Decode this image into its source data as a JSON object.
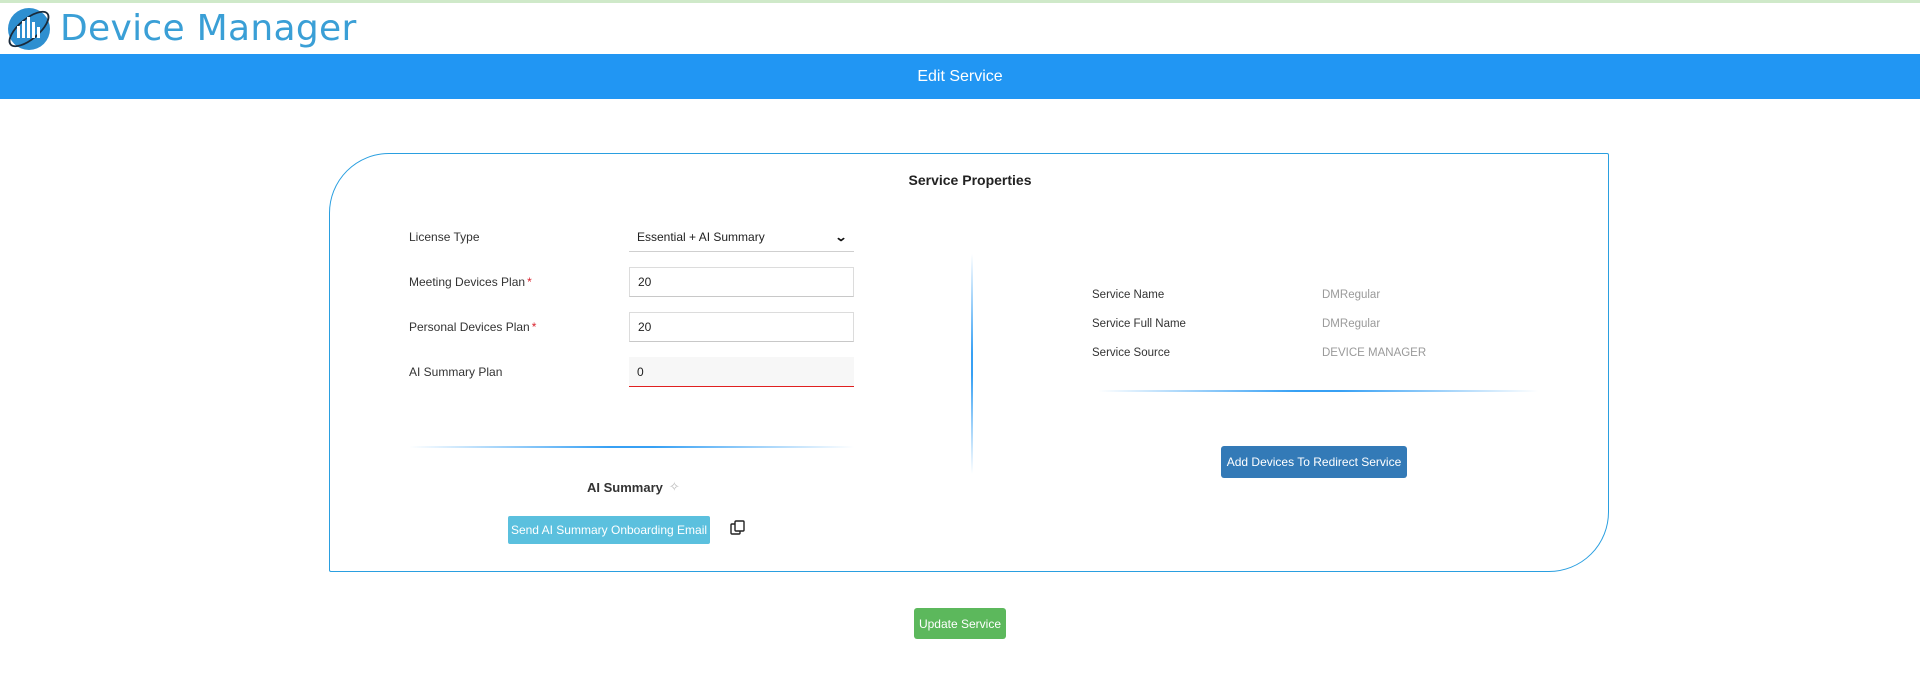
{
  "app": {
    "title": "Device Manager"
  },
  "page": {
    "title": "Edit Service"
  },
  "card": {
    "title": "Service Properties"
  },
  "form": {
    "license_type": {
      "label": "License Type",
      "value": "Essential + AI Summary"
    },
    "meeting_devices_plan": {
      "label": "Meeting Devices Plan",
      "required_mark": "*",
      "value": "20"
    },
    "personal_devices_plan": {
      "label": "Personal Devices Plan",
      "required_mark": "*",
      "value": "20"
    },
    "ai_summary_plan": {
      "label": "AI Summary Plan",
      "value": "0"
    }
  },
  "ai_summary": {
    "title": "AI Summary",
    "send_button_label": "Send AI Summary Onboarding Email"
  },
  "service_info": [
    {
      "label": "Service Name",
      "value": "DMRegular"
    },
    {
      "label": "Service Full Name",
      "value": "DMRegular"
    },
    {
      "label": "Service Source",
      "value": "DEVICE MANAGER"
    }
  ],
  "actions": {
    "add_devices_label": "Add Devices To Redirect Service",
    "update_label": "Update Service"
  },
  "icons": {
    "logo": "device-manager-logo-icon",
    "sparkle": "sparkle-icon",
    "copy": "copy-icon",
    "dropdown": "chevron-down-icon"
  },
  "colors": {
    "brand": "#3a9fd6",
    "banner": "#2196f3",
    "info_button": "#5bc0de",
    "primary_button": "#337ab7",
    "success_button": "#5cb85c",
    "required": "#d9232e",
    "invalid_border": "#e02020"
  }
}
